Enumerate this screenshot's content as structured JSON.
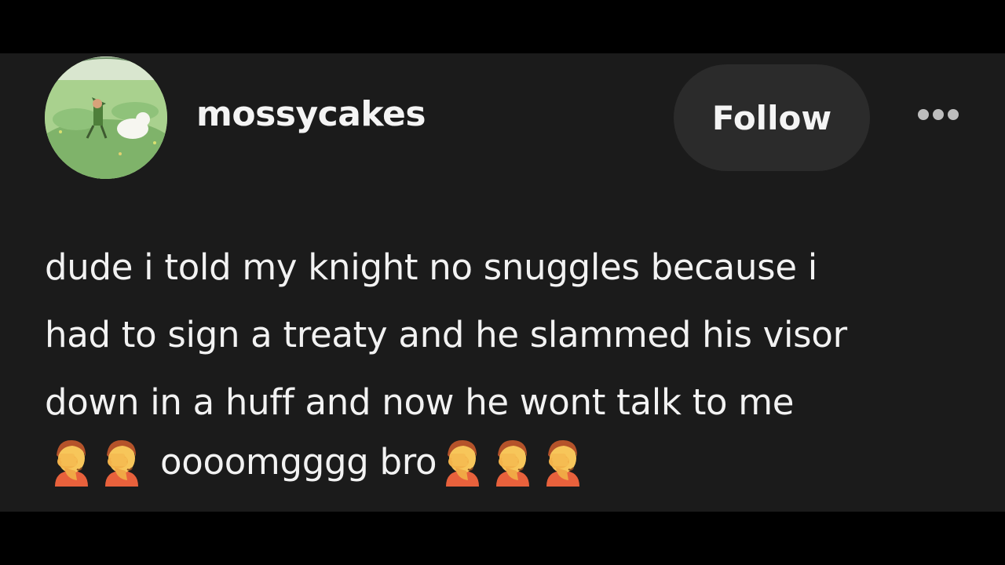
{
  "post": {
    "username": "mossycakes",
    "follow_label": "Follow",
    "body_lines": [
      "dude i told my knight no snuggles because i",
      "had to sign a treaty and he slammed his visor",
      "down in a huff and now he wont talk to me"
    ],
    "last_line_text": "oooomgggg bro",
    "emoji_name": "face-palm-emoji"
  },
  "icons": {
    "more": "ellipsis-icon",
    "avatar": "avatar-image"
  },
  "colors": {
    "background": "#000000",
    "post_background": "#1b1b1b",
    "text": "#f2f2f2",
    "button_background": "#2b2b2b",
    "dots": "#bdbdbd"
  }
}
